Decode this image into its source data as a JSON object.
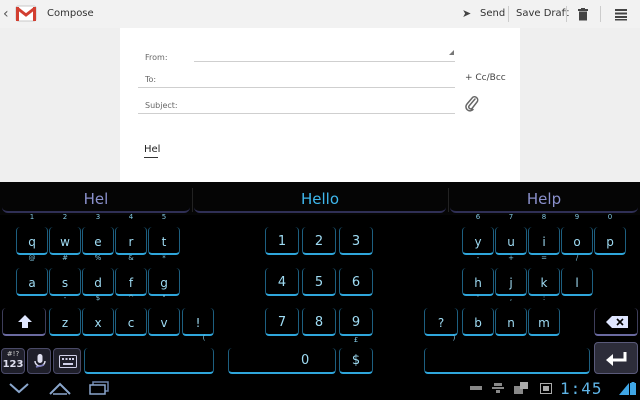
{
  "actionbar": {
    "title": "Compose",
    "send_label": "Send",
    "save_draft_label": "Save Draft"
  },
  "compose": {
    "from_label": "From:",
    "to_label": "To:",
    "cc_bcc_label": "+ Cc/Bcc",
    "subject_label": "Subject:",
    "body_text": "Hel"
  },
  "suggestions": [
    "Hel",
    "Hello",
    "Help"
  ],
  "keyboard": {
    "left": {
      "row1": [
        {
          "k": "q",
          "h": "1"
        },
        {
          "k": "w",
          "h": "2"
        },
        {
          "k": "e",
          "h": "3"
        },
        {
          "k": "r",
          "h": "4"
        },
        {
          "k": "t",
          "h": "5"
        }
      ],
      "row2": [
        {
          "k": "a",
          "h": "@"
        },
        {
          "k": "s",
          "h": "#"
        },
        {
          "k": "d",
          "h": "%"
        },
        {
          "k": "f",
          "h": "&"
        },
        {
          "k": "g",
          "h": "*"
        }
      ],
      "row3": [
        {
          "k": "z",
          "h": "-"
        },
        {
          "k": "x",
          "h": "$"
        },
        {
          "k": "c",
          "h": "^"
        },
        {
          "k": "v",
          "h": "\""
        },
        {
          "k": "!",
          "h": ""
        }
      ],
      "row4_hint": "("
    },
    "numpad": {
      "row1": [
        "1",
        "2",
        "3"
      ],
      "row2": [
        "4",
        "5",
        "6"
      ],
      "row3": [
        "7",
        "8",
        "9"
      ],
      "zero": "0",
      "dollar": "$",
      "dollar_hint": "£"
    },
    "right": {
      "row1": [
        {
          "k": "y",
          "h": "6"
        },
        {
          "k": "u",
          "h": "7"
        },
        {
          "k": "i",
          "h": "8"
        },
        {
          "k": "o",
          "h": "9"
        },
        {
          "k": "p",
          "h": "0"
        }
      ],
      "row2": [
        {
          "k": "h",
          "h": "-"
        },
        {
          "k": "j",
          "h": "+"
        },
        {
          "k": "k",
          "h": "="
        },
        {
          "k": "l",
          "h": "/"
        }
      ],
      "row3": [
        {
          "k": "?",
          "h": ""
        },
        {
          "k": "b",
          "h": "'"
        },
        {
          "k": "n",
          "h": ","
        },
        {
          "k": "m",
          "h": ":"
        }
      ],
      "row4_hint": ")"
    },
    "symbols_key": "123",
    "symbols_hint": "#!?"
  },
  "statusbar": {
    "time": "1:45"
  },
  "icons": {
    "back": "back-arrow-icon",
    "gmail": "gmail-logo-icon",
    "send": "send-icon",
    "trash": "trash-icon",
    "menu": "menu-icon",
    "attach": "paperclip-icon",
    "shift": "shift-icon",
    "mic": "microphone-icon",
    "settings": "keyboard-settings-icon",
    "delete": "backspace-icon",
    "enter": "enter-icon",
    "nav_back": "nav-back-icon",
    "nav_home": "nav-home-icon",
    "nav_recent": "nav-recent-apps-icon"
  },
  "colors": {
    "key_accent": "#2fa6db",
    "suggestion_highlight": "#3fb8ee",
    "suggestion_normal": "#8a90cc",
    "clock": "#5fb4e6"
  }
}
